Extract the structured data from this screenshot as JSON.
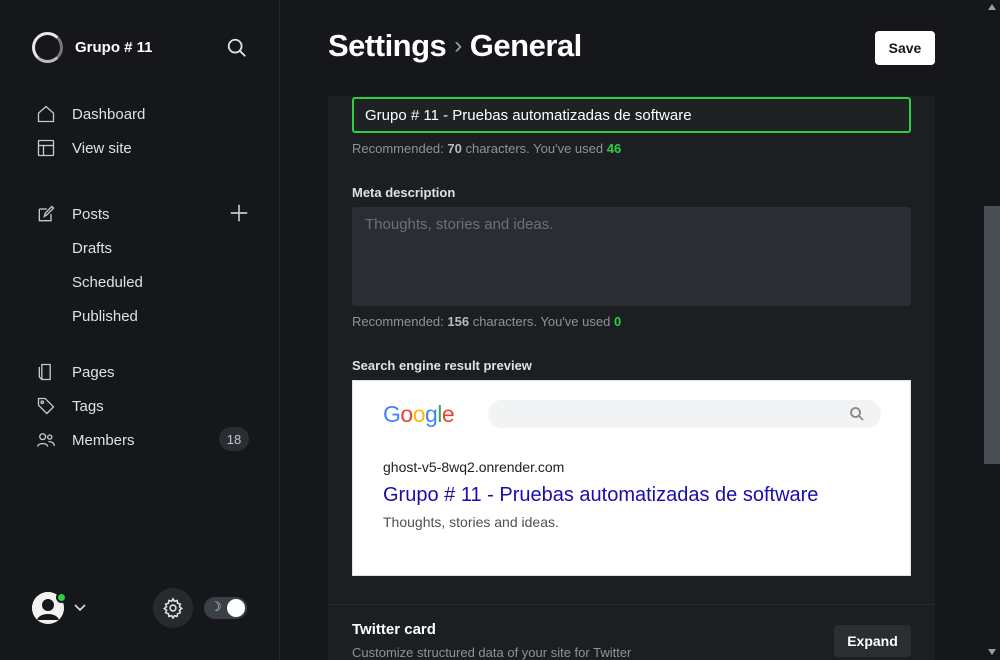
{
  "brand": {
    "name": "Grupo # 11"
  },
  "sidebar": {
    "nav": [
      {
        "label": "Dashboard",
        "icon": "house-icon"
      },
      {
        "label": "View site",
        "icon": "layout-icon"
      }
    ],
    "posts": {
      "label": "Posts",
      "icon": "edit-icon",
      "sub": [
        "Drafts",
        "Scheduled",
        "Published"
      ]
    },
    "more": [
      {
        "label": "Pages",
        "icon": "pages-icon"
      },
      {
        "label": "Tags",
        "icon": "tag-icon"
      },
      {
        "label": "Members",
        "icon": "members-icon",
        "badge": "18"
      }
    ]
  },
  "header": {
    "title_part1": "Settings",
    "separator": "›",
    "title_part2": "General",
    "save_label": "Save"
  },
  "meta": {
    "title_value": "Grupo # 11 - Pruebas automatizadas de software",
    "title_hint_prefix": "Recommended: ",
    "title_hint_max": "70",
    "title_hint_mid": " characters. You've used ",
    "title_hint_used": "46",
    "description_label": "Meta description",
    "description_placeholder": "Thoughts, stories and ideas.",
    "desc_hint_prefix": "Recommended: ",
    "desc_hint_max": "156",
    "desc_hint_mid": " characters. You've used ",
    "desc_hint_used": "0"
  },
  "serp": {
    "label": "Search engine result preview",
    "logo_letters": [
      "G",
      "o",
      "o",
      "g",
      "l",
      "e"
    ],
    "url": "ghost-v5-8wq2.onrender.com",
    "title": "Grupo # 11 - Pruebas automatizadas de software",
    "description": "Thoughts, stories and ideas."
  },
  "twitter": {
    "title": "Twitter card",
    "description": "Customize structured data of your site for Twitter",
    "expand_label": "Expand"
  },
  "colors": {
    "accent_green": "#30cf43",
    "link_blue": "#1a0dab",
    "google_blue": "#4285f4",
    "google_red": "#ea4335",
    "google_yellow": "#fbbc05",
    "google_green": "#34a853"
  }
}
